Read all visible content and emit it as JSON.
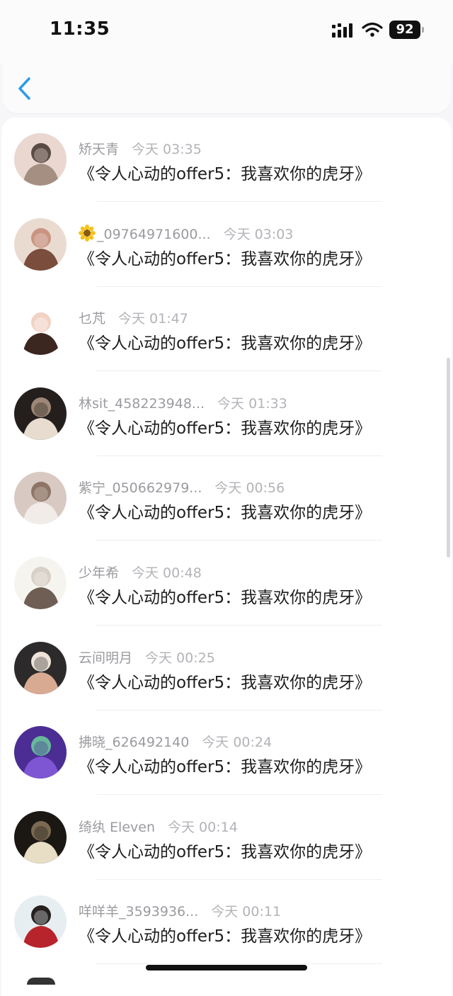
{
  "status_bar": {
    "time": "11:35",
    "battery": "92"
  },
  "header": {
    "back_icon": "chevron-left-icon",
    "accent": "#2a9be8"
  },
  "list": {
    "items": [
      {
        "name": "矫天青",
        "time": "今天 03:35",
        "message": "《令人心动的offer5：我喜欢你的虎牙》",
        "avatar_palette": [
          "#e9d7d0",
          "#a58f82",
          "#5a4c45"
        ]
      },
      {
        "name": "_09764971600...",
        "name_icon": "sunflower-icon",
        "time": "今天 03:03",
        "message": "《令人心动的offer5：我喜欢你的虎牙》",
        "avatar_palette": [
          "#eadbd1",
          "#7a4d3c",
          "#c99481"
        ]
      },
      {
        "name": "乜芃",
        "time": "今天 01:47",
        "message": "《令人心动的offer5：我喜欢你的虎牙》",
        "avatar_palette": [
          "#ffffff",
          "#3b2620",
          "#f1d2c3"
        ]
      },
      {
        "name": "林sit_458223948...",
        "time": "今天 01:33",
        "message": "《令人心动的offer5：我喜欢你的虎牙》",
        "avatar_palette": [
          "#241f1c",
          "#e7dccf",
          "#9d8777"
        ]
      },
      {
        "name": "紫宁_050662979...",
        "time": "今天 00:56",
        "message": "《令人心动的offer5：我喜欢你的虎牙》",
        "avatar_palette": [
          "#d8cac3",
          "#f2ece8",
          "#8d7467"
        ]
      },
      {
        "name": "少年希",
        "time": "今天 00:48",
        "message": "《令人心动的offer5：我喜欢你的虎牙》",
        "avatar_palette": [
          "#f6f4ef",
          "#6e5e53",
          "#d8cfc6"
        ]
      },
      {
        "name": "云间明月",
        "time": "今天 00:25",
        "message": "《令人心动的offer5：我喜欢你的虎牙》",
        "avatar_palette": [
          "#2c2a2b",
          "#d9aa92",
          "#efe3d9"
        ]
      },
      {
        "name": "拂晓_626492140",
        "time": "今天 00:24",
        "message": "《令人心动的offer5：我喜欢你的虎牙》",
        "avatar_palette": [
          "#4b2d94",
          "#7e55d2",
          "#67b99b"
        ]
      },
      {
        "name": "绮纨 Eleven",
        "time": "今天 00:14",
        "message": "《令人心动的offer5：我喜欢你的虎牙》",
        "avatar_palette": [
          "#1b1713",
          "#e8ddc5",
          "#7b6a52"
        ]
      },
      {
        "name": "咩咩羊_3593936...",
        "time": "今天 00:11",
        "message": "《令人心动的offer5：我喜欢你的虎牙》",
        "avatar_palette": [
          "#e7eef1",
          "#b8242b",
          "#25211f"
        ]
      }
    ]
  }
}
